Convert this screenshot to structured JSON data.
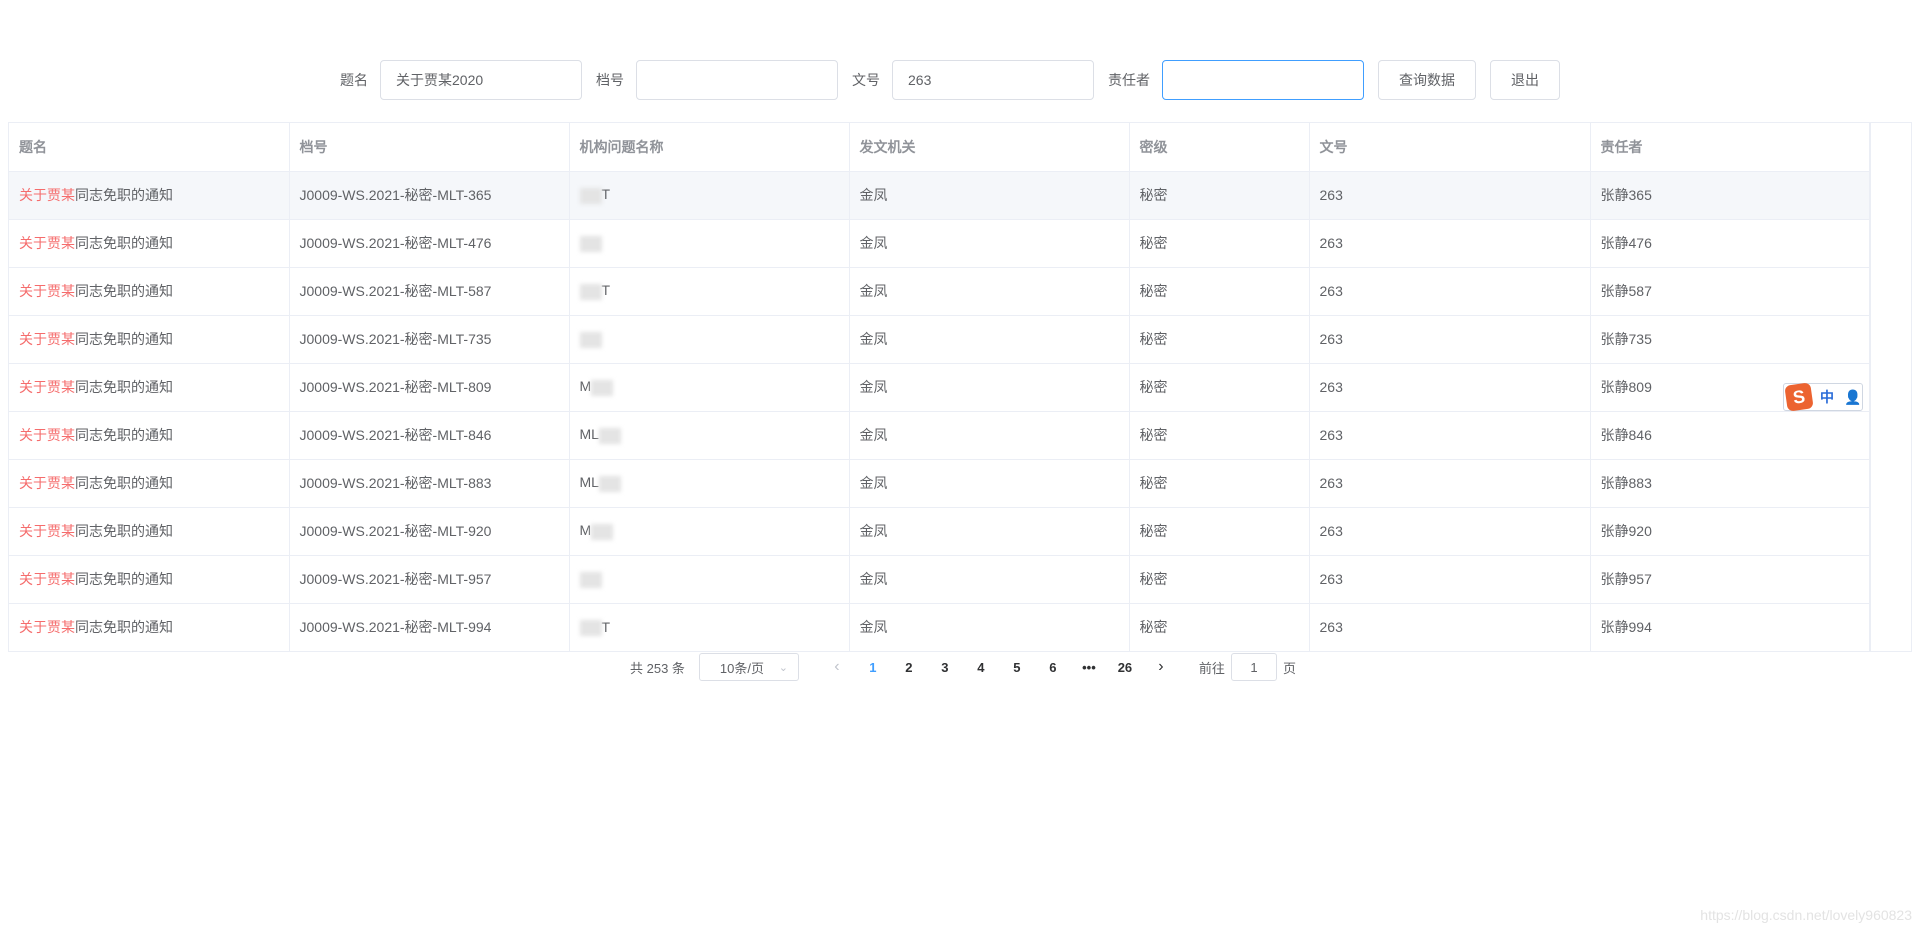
{
  "search": {
    "title_label": "题名",
    "title_value": "关于贾某2020",
    "archive_label": "档号",
    "archive_value": "",
    "doc_label": "文号",
    "doc_value": "263",
    "owner_label": "责任者",
    "owner_value": "",
    "query_button": "查询数据",
    "exit_button": "退出"
  },
  "table": {
    "headers": [
      "题名",
      "档号",
      "机构问题名称",
      "发文机关",
      "密级",
      "文号",
      "责任者"
    ],
    "rows": [
      {
        "title_hl": "关于贾某",
        "title_rest": "同志免职的通知",
        "archive": "J0009-WS.2021-秘密-MLT-365",
        "org_suffix": "T",
        "issuer": "金凤",
        "level": "秘密",
        "doc": "263",
        "owner": "张静365"
      },
      {
        "title_hl": "关于贾某",
        "title_rest": "同志免职的通知",
        "archive": "J0009-WS.2021-秘密-MLT-476",
        "org_suffix": "",
        "issuer": "金凤",
        "level": "秘密",
        "doc": "263",
        "owner": "张静476"
      },
      {
        "title_hl": "关于贾某",
        "title_rest": "同志免职的通知",
        "archive": "J0009-WS.2021-秘密-MLT-587",
        "org_suffix": "T",
        "issuer": "金凤",
        "level": "秘密",
        "doc": "263",
        "owner": "张静587"
      },
      {
        "title_hl": "关于贾某",
        "title_rest": "同志免职的通知",
        "archive": "J0009-WS.2021-秘密-MLT-735",
        "org_suffix": "",
        "issuer": "金凤",
        "level": "秘密",
        "doc": "263",
        "owner": "张静735"
      },
      {
        "title_hl": "关于贾某",
        "title_rest": "同志免职的通知",
        "archive": "J0009-WS.2021-秘密-MLT-809",
        "org_prefix": "M",
        "issuer": "金凤",
        "level": "秘密",
        "doc": "263",
        "owner": "张静809"
      },
      {
        "title_hl": "关于贾某",
        "title_rest": "同志免职的通知",
        "archive": "J0009-WS.2021-秘密-MLT-846",
        "org_prefix": "ML",
        "issuer": "金凤",
        "level": "秘密",
        "doc": "263",
        "owner": "张静846"
      },
      {
        "title_hl": "关于贾某",
        "title_rest": "同志免职的通知",
        "archive": "J0009-WS.2021-秘密-MLT-883",
        "org_prefix": "ML",
        "issuer": "金凤",
        "level": "秘密",
        "doc": "263",
        "owner": "张静883"
      },
      {
        "title_hl": "关于贾某",
        "title_rest": "同志免职的通知",
        "archive": "J0009-WS.2021-秘密-MLT-920",
        "org_prefix": "M",
        "issuer": "金凤",
        "level": "秘密",
        "doc": "263",
        "owner": "张静920"
      },
      {
        "title_hl": "关于贾某",
        "title_rest": "同志免职的通知",
        "archive": "J0009-WS.2021-秘密-MLT-957",
        "org_suffix": "",
        "issuer": "金凤",
        "level": "秘密",
        "doc": "263",
        "owner": "张静957"
      },
      {
        "title_hl": "关于贾某",
        "title_rest": "同志免职的通知",
        "archive": "J0009-WS.2021-秘密-MLT-994",
        "org_suffix": "T",
        "issuer": "金凤",
        "level": "秘密",
        "doc": "263",
        "owner": "张静994"
      }
    ]
  },
  "pagination": {
    "total": "共 253 条",
    "page_size": "10条/页",
    "pages": [
      "1",
      "2",
      "3",
      "4",
      "5",
      "6",
      "•••",
      "26"
    ],
    "current": "1",
    "jump_prefix": "前往",
    "jump_value": "1",
    "jump_suffix": "页"
  },
  "ime": {
    "logo": "S",
    "mode": "中"
  },
  "watermark": "https://blog.csdn.net/lovely960823",
  "colors": {
    "highlight": "#f56c6c",
    "accent": "#409eff"
  }
}
